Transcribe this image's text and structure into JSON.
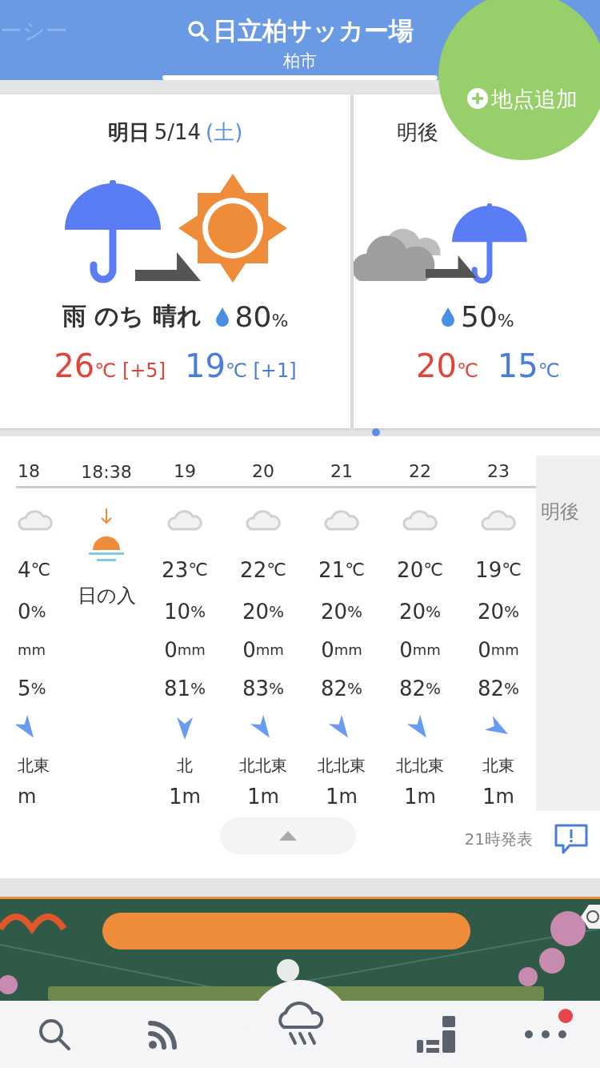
{
  "header": {
    "prev_tab": "ーシー",
    "title": "日立柏サッカー場",
    "subtitle": "柏市"
  },
  "add_location": "地点追加",
  "days": [
    {
      "kind": "full",
      "label": "明日",
      "date": "5/14",
      "weekday": "(土)",
      "icons": [
        {
          "kind": "rain"
        },
        {
          "kind": "sun"
        }
      ],
      "summary": "雨 のち 晴れ",
      "precip": {
        "value": "80",
        "unit": "%"
      },
      "high": {
        "value": "26",
        "unit": "℃",
        "diff": "[+5]"
      },
      "low": {
        "value": "19",
        "unit": "℃",
        "diff": "[+1]"
      }
    },
    {
      "kind": "partial",
      "label": "明後",
      "icons": [
        {
          "kind": "cloud"
        },
        {
          "kind": "rain"
        }
      ],
      "precip": {
        "value": "50",
        "unit": "%"
      },
      "high": {
        "value": "20",
        "unit": "℃"
      },
      "low": {
        "value": "15",
        "unit": "℃"
      }
    }
  ],
  "hourly": {
    "columns": [
      {
        "kind": "partial",
        "time": "18",
        "sky": {
          "kind": "cloud"
        },
        "temp": "4",
        "temp_unit": "℃",
        "pop": "0",
        "pop_unit": "%",
        "rain_unit": "mm",
        "humidity": "5",
        "humidity_unit": "%",
        "wind_arrow": {
          "kind": "nne"
        },
        "wind_dir": "北東",
        "wind_unit": "m"
      },
      {
        "kind": "sunset",
        "time": "18:38",
        "label": "日の入"
      },
      {
        "kind": "hour",
        "time": "19",
        "sky": {
          "kind": "cloud"
        },
        "temp": "23",
        "temp_unit": "℃",
        "pop": "10",
        "pop_unit": "%",
        "rain": "0",
        "rain_unit": "mm",
        "humidity": "81",
        "humidity_unit": "%",
        "wind_arrow": {
          "kind": "n"
        },
        "wind_dir": "北",
        "wind_speed": "1",
        "wind_unit": "m"
      },
      {
        "kind": "hour",
        "time": "20",
        "sky": {
          "kind": "cloud"
        },
        "temp": "22",
        "temp_unit": "℃",
        "pop": "20",
        "pop_unit": "%",
        "rain": "0",
        "rain_unit": "mm",
        "humidity": "83",
        "humidity_unit": "%",
        "wind_arrow": {
          "kind": "nne"
        },
        "wind_dir": "北北東",
        "wind_speed": "1",
        "wind_unit": "m"
      },
      {
        "kind": "hour",
        "time": "21",
        "sky": {
          "kind": "cloud"
        },
        "temp": "21",
        "temp_unit": "℃",
        "pop": "20",
        "pop_unit": "%",
        "rain": "0",
        "rain_unit": "mm",
        "humidity": "82",
        "humidity_unit": "%",
        "wind_arrow": {
          "kind": "nne"
        },
        "wind_dir": "北北東",
        "wind_speed": "1",
        "wind_unit": "m"
      },
      {
        "kind": "hour",
        "time": "22",
        "sky": {
          "kind": "cloud"
        },
        "temp": "20",
        "temp_unit": "℃",
        "pop": "20",
        "pop_unit": "%",
        "rain": "0",
        "rain_unit": "mm",
        "humidity": "82",
        "humidity_unit": "%",
        "wind_arrow": {
          "kind": "nne"
        },
        "wind_dir": "北北東",
        "wind_speed": "1",
        "wind_unit": "m"
      },
      {
        "kind": "hour",
        "time": "23",
        "sky": {
          "kind": "cloud"
        },
        "temp": "19",
        "temp_unit": "℃",
        "pop": "20",
        "pop_unit": "%",
        "rain": "0",
        "rain_unit": "mm",
        "humidity": "82",
        "humidity_unit": "%",
        "wind_arrow": {
          "kind": "ne"
        },
        "wind_dir": "北東",
        "wind_speed": "1",
        "wind_unit": "m"
      }
    ],
    "next_day": "明後",
    "issued": "21時発表"
  },
  "nav": [
    {
      "kind": "search",
      "selected": false,
      "badge": false
    },
    {
      "kind": "feed",
      "selected": false,
      "badge": false
    },
    {
      "kind": "rain",
      "selected": true,
      "badge": false
    },
    {
      "kind": "ranking",
      "selected": false,
      "badge": false
    },
    {
      "kind": "more",
      "selected": false,
      "badge": true
    }
  ]
}
